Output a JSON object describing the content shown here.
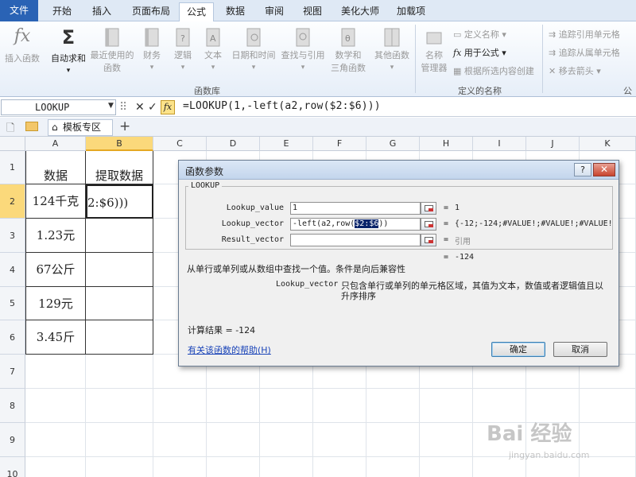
{
  "tabs": [
    "文件",
    "开始",
    "插入",
    "页面布局",
    "公式",
    "数据",
    "审阅",
    "视图",
    "美化大师",
    "加载项"
  ],
  "ribbon": {
    "insert_func": "插入函数",
    "autosum": "自动求和",
    "recent": [
      "最近使用的",
      "函数"
    ],
    "finance": "财务",
    "logic": "逻辑",
    "text": "文本",
    "datetime": "日期和时间",
    "lookup": "查找与引用",
    "math": [
      "数学和",
      "三角函数"
    ],
    "other": "其他函数",
    "group_funclib": "函数库",
    "name_mgr": [
      "名称",
      "管理器"
    ],
    "define_name": "定义名称",
    "use_in_formula": "用于公式",
    "create_from_sel": "根据所选内容创建",
    "group_names": "定义的名称",
    "trace_prec": "追踪引用单元格",
    "trace_dep": "追踪从属单元格",
    "remove_arrows": "移去箭头",
    "group_audit": "公式"
  },
  "formula_bar": {
    "name_box": "LOOKUP",
    "cancel": "✕",
    "enter": "✓",
    "fx": "fx",
    "formula": "=LOOKUP(1,-left(a2,row($2:$6)))"
  },
  "workbook_tab": "模板专区",
  "columns": [
    "A",
    "B",
    "C",
    "D",
    "E",
    "F",
    "G",
    "H",
    "I",
    "J",
    "K"
  ],
  "rows": [
    "1",
    "2",
    "3",
    "4",
    "5",
    "6",
    "7",
    "8",
    "9",
    "10"
  ],
  "cells": {
    "A1": "数据",
    "B1": "提取数据",
    "A2": "124千克",
    "B2": "2:$6)))",
    "A3": "1.23元",
    "A4": "67公斤",
    "A5": "129元",
    "A6": "3.45斤"
  },
  "dialog": {
    "title": "函数参数",
    "help_btn": "?",
    "close_btn": "✕",
    "function_name": "LOOKUP",
    "args": [
      {
        "label": "Lookup_value",
        "value": "1",
        "result": "1"
      },
      {
        "label": "Lookup_vector",
        "value_pre": "-left(a2,row(",
        "value_sel": "$2:$6",
        "value_post": "))",
        "result": "{-12;-124;#VALUE!;#VALUE!;#VALUE!"
      },
      {
        "label": "Result_vector",
        "value": "",
        "result": "引用"
      }
    ],
    "eq": "=",
    "overall_result": "-124",
    "description": "从单行或单列或从数组中查找一个值。条件是向后兼容性",
    "arg_desc_name": "Lookup_vector",
    "arg_desc_1": "只包含单行或单列的单元格区域，其值为文本，数值或者逻辑值且以",
    "arg_desc_2": "升序排序",
    "calc_result": "计算结果 = -124",
    "help_link": "有关该函数的帮助(H)",
    "ok": "确定",
    "cancel": "取消"
  },
  "watermark": {
    "brand": "Bai 经验",
    "url": "jingyan.baidu.com"
  }
}
